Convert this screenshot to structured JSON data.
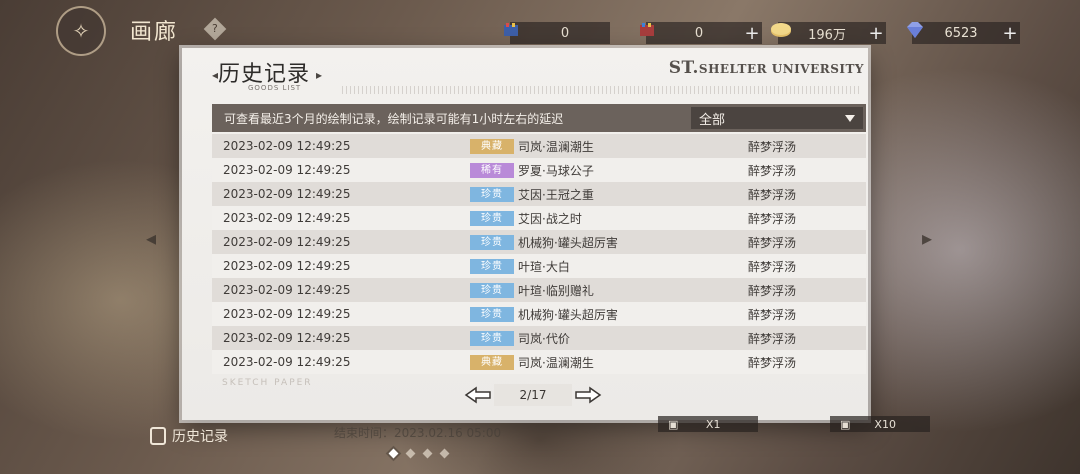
{
  "header": {
    "title": "画廊",
    "help_icon": "diamond-help-icon",
    "logo_icon": "butterfly-icon"
  },
  "resources": [
    {
      "icon": "ticket-blue-icon",
      "value": "0",
      "has_plus": false
    },
    {
      "icon": "ticket-red-icon",
      "value": "0",
      "has_plus": true
    },
    {
      "icon": "coin-icon",
      "value": "196万",
      "has_plus": true
    },
    {
      "icon": "diamond-icon",
      "value": "6523",
      "has_plus": true
    }
  ],
  "panel": {
    "title": "历史记录",
    "subtitle": "GOODS LIST",
    "brand_big": "ST.",
    "brand_rest": "SHELTER UNIVERSITY",
    "filter_text": "可查看最近3个月的绘制记录，绘制记录可能有1小时左右的延迟",
    "filter_selected": "全部",
    "sketch_text": "SKETCH PAPER",
    "page_indicator": "2/17"
  },
  "rarity_colors": {
    "典藏": "#d8b26a",
    "稀有": "#b98ad8",
    "珍贵": "#7fb6e0"
  },
  "records": [
    {
      "time": "2023-02-09  12:49:25",
      "rarity": "典藏",
      "item": "司岚·温澜潮生",
      "source": "醉梦浮汤"
    },
    {
      "time": "2023-02-09  12:49:25",
      "rarity": "稀有",
      "item": "罗夏·马球公子",
      "source": "醉梦浮汤"
    },
    {
      "time": "2023-02-09  12:49:25",
      "rarity": "珍贵",
      "item": "艾因·王冠之重",
      "source": "醉梦浮汤"
    },
    {
      "time": "2023-02-09  12:49:25",
      "rarity": "珍贵",
      "item": "艾因·战之时",
      "source": "醉梦浮汤"
    },
    {
      "time": "2023-02-09  12:49:25",
      "rarity": "珍贵",
      "item": "机械狗·罐头超厉害",
      "source": "醉梦浮汤"
    },
    {
      "time": "2023-02-09  12:49:25",
      "rarity": "珍贵",
      "item": "叶瑄·大白",
      "source": "醉梦浮汤"
    },
    {
      "time": "2023-02-09  12:49:25",
      "rarity": "珍贵",
      "item": "叶瑄·临别赠礼",
      "source": "醉梦浮汤"
    },
    {
      "time": "2023-02-09  12:49:25",
      "rarity": "珍贵",
      "item": "机械狗·罐头超厉害",
      "source": "醉梦浮汤"
    },
    {
      "time": "2023-02-09  12:49:25",
      "rarity": "珍贵",
      "item": "司岚·代价",
      "source": "醉梦浮汤"
    },
    {
      "time": "2023-02-09  12:49:25",
      "rarity": "典藏",
      "item": "司岚·温澜潮生",
      "source": "醉梦浮汤"
    }
  ],
  "bottom": {
    "history_label": "历史记录",
    "end_time": "结束时间：2023.02.16  05:00",
    "draw_once": "X1",
    "draw_ten": "X10"
  }
}
